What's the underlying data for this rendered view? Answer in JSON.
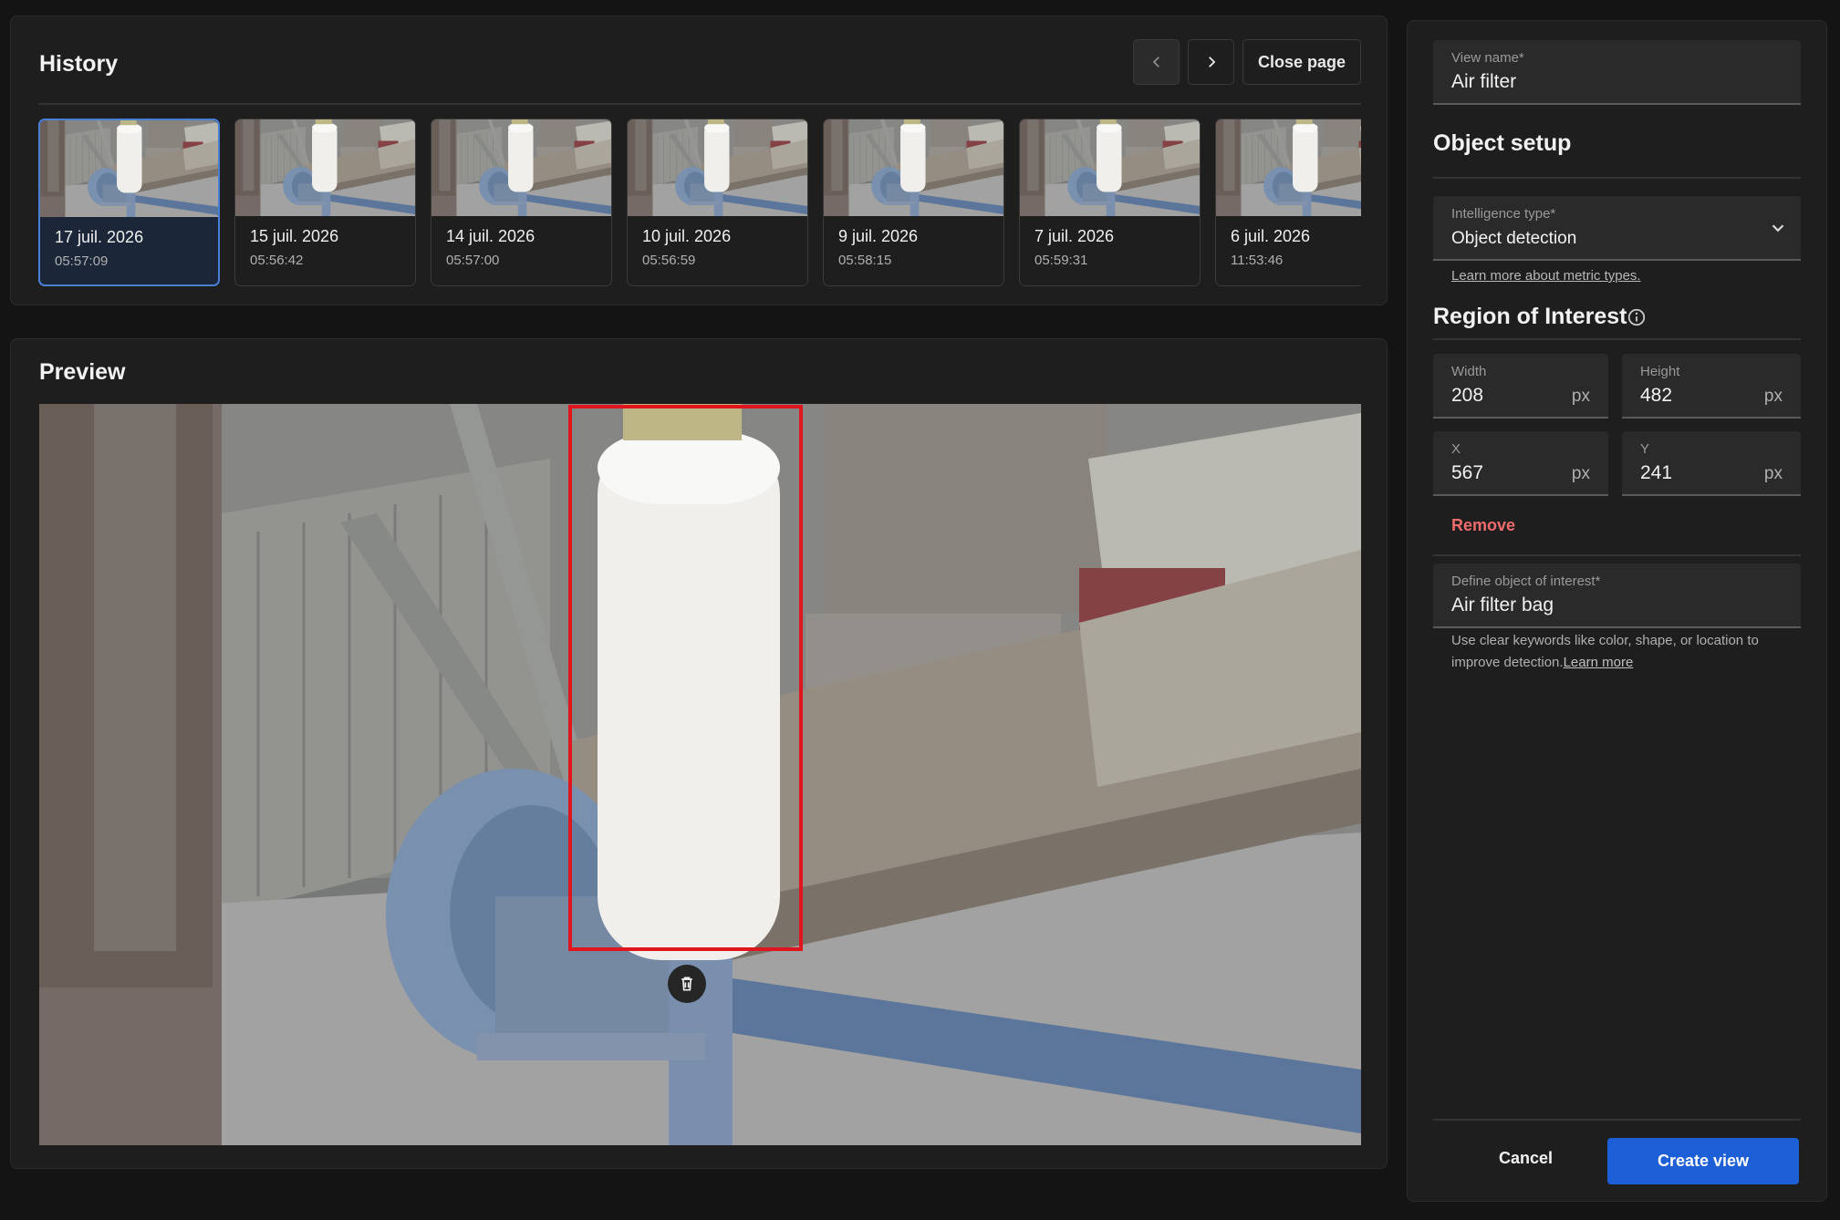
{
  "history": {
    "title": "History",
    "prev_icon": "chevron-left-icon",
    "next_icon": "chevron-right-icon",
    "close_label": "Close page",
    "items": [
      {
        "date": "17 juil. 2026",
        "time": "05:57:09",
        "active": true
      },
      {
        "date": "15 juil. 2026",
        "time": "05:56:42",
        "active": false
      },
      {
        "date": "14 juil. 2026",
        "time": "05:57:00",
        "active": false
      },
      {
        "date": "10 juil. 2026",
        "time": "05:56:59",
        "active": false
      },
      {
        "date": "9 juil. 2026",
        "time": "05:58:15",
        "active": false
      },
      {
        "date": "7 juil. 2026",
        "time": "05:59:31",
        "active": false
      },
      {
        "date": "6 juil. 2026",
        "time": "11:53:46",
        "active": false
      }
    ]
  },
  "preview": {
    "title": "Preview",
    "delete_icon": "trash-icon"
  },
  "setup": {
    "view_name": {
      "label": "View name*",
      "value": "Air filter"
    },
    "object_setup_title": "Object setup",
    "intelligence": {
      "label": "Intelligence type*",
      "value": "Object detection",
      "icon": "chevron-down-icon"
    },
    "metric_link": "Learn more about metric types.",
    "roi_title": "Region of Interest",
    "roi_icon": "info-icon",
    "width": {
      "label": "Width",
      "value": "208",
      "unit": "px"
    },
    "height": {
      "label": "Height",
      "value": "482",
      "unit": "px"
    },
    "x": {
      "label": "X",
      "value": "567",
      "unit": "px"
    },
    "y": {
      "label": "Y",
      "value": "241",
      "unit": "px"
    },
    "remove_label": "Remove",
    "object_of_interest": {
      "label": "Define object of interest*",
      "value": "Air filter bag"
    },
    "hint_text": "Use clear keywords like color, shape, or location to improve detection.",
    "hint_link": "Learn more",
    "cancel_label": "Cancel",
    "create_label": "Create view"
  },
  "colors": {
    "accent": "#1c5fd6",
    "roi": "#e0161e",
    "remove": "#f06b6b"
  }
}
